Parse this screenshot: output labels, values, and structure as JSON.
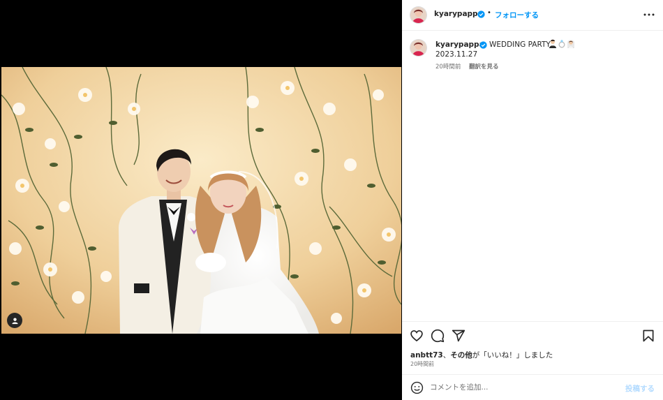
{
  "post": {
    "username": "kyarypappa",
    "follow_label": "フォローする",
    "dot": "•",
    "more_icon": "more-horizontal-icon"
  },
  "caption": {
    "username": "kyarypappa",
    "text": "WEDDING PARTY",
    "emojis": [
      "groom-emoji",
      "ring-emoji",
      "bride-emoji"
    ],
    "date_line": "2023.11.27",
    "time_ago": "20時間前",
    "translate_label": "翻訳を見る"
  },
  "actions": {
    "icons": [
      "heart-icon",
      "comment-icon",
      "share-icon",
      "bookmark-icon"
    ]
  },
  "likes": {
    "user": "anbtt73",
    "text_mid": "、",
    "others": "その他",
    "text_end": "が「いいね！」しました"
  },
  "posted_ago": "20時間前",
  "comment": {
    "placeholder": "コメントを追加...",
    "post_label": "投稿する"
  },
  "colors": {
    "accent": "#0095f6",
    "post_disabled": "#b3dbff",
    "verified": "#0095f6",
    "muted": "#737373"
  }
}
